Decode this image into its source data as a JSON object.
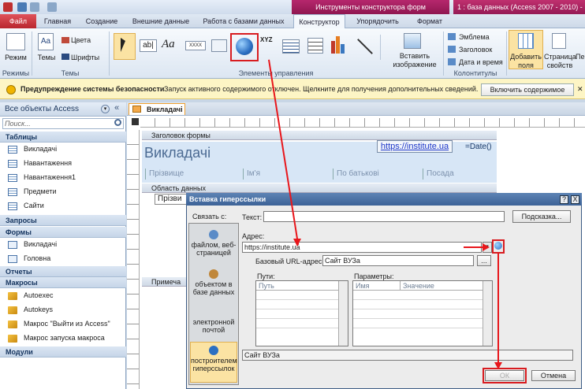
{
  "window": {
    "context_title": "Инструменты конструктора форм",
    "title": "1 : база данных (Access 2007 - 2010) - Micr"
  },
  "tabs": [
    "Файл",
    "Главная",
    "Создание",
    "Внешние данные",
    "Работа с базами данных",
    "Конструктор",
    "Упорядочить",
    "Формат"
  ],
  "ribbon": {
    "mode_label": "Режим",
    "themes_label": "Темы",
    "colors_label": "Цвета",
    "fonts_label": "Шрифты",
    "group_modes": "Режимы",
    "group_themes": "Темы",
    "group_controls": "Элементы управления",
    "group_headers": "Колонтитулы",
    "insert_image": "Вставить изображение",
    "emblem": "Эмблема",
    "heading": "Заголовок",
    "date_time": "Дата и время",
    "add_fields": "Добавить поля",
    "property_sheet": "Страница свойств",
    "controls_text": [
      "ab|",
      "Aa",
      "XXXX",
      "XYZ"
    ],
    "more": "Пе"
  },
  "security": {
    "title": "Предупреждение системы безопасности",
    "message": "Запуск активного содержимого отключен. Щелкните для получения дополнительных сведений.",
    "button": "Включить содержимое"
  },
  "nav": {
    "header": "Все объекты Access",
    "search_placeholder": "Поиск...",
    "categories": [
      {
        "name": "Таблицы",
        "items": [
          "Викладачі",
          "Навантаження",
          "Навантаження1",
          "Предмети",
          "Сайти"
        ]
      },
      {
        "name": "Запросы",
        "items": []
      },
      {
        "name": "Формы",
        "items": [
          "Викладачі",
          "Головна"
        ]
      },
      {
        "name": "Отчеты",
        "items": []
      },
      {
        "name": "Макросы",
        "items": [
          "Autoexec",
          "Autokeys",
          "Макрос \"Выйти из Access\"",
          "Макрос запуска макроса"
        ]
      },
      {
        "name": "Модули",
        "items": []
      }
    ]
  },
  "document": {
    "tab_name": "Викладачі",
    "section_header": "Заголовок формы",
    "section_detail": "Область данных",
    "section_footer": "Примеча",
    "form_title": "Викладачі",
    "hyperlink": "https://institute.ua",
    "date_fn": "=Date()",
    "columns": [
      "Прізвище",
      "Ім'я",
      "По батькові",
      "Посада"
    ],
    "detail_field": "Прізви"
  },
  "dialog": {
    "title": "Вставка гиперссылки",
    "help": "?",
    "close": "X",
    "link_to": "Связать с:",
    "text_label": "Текст:",
    "text_value": "",
    "tooltip_button": "Подсказка...",
    "address_label": "Адрес:",
    "address_value": "https://institute.ua",
    "base_url_label": "Базовый URL-адрес:",
    "base_url_value": "Сайт ВУЗа",
    "browse_button": "...",
    "paths_label": "Пути:",
    "params_label": "Параметры:",
    "paths_column": "Путь",
    "params_columns": [
      "Имя",
      "Значение"
    ],
    "preview": "Сайт ВУЗа",
    "ok": "ОК",
    "cancel": "Отмена",
    "link_options": [
      "файлом, веб-страницей",
      "объектом в базе данных",
      "электронной почтой",
      "построителем гиперссылок"
    ]
  },
  "colors": {
    "accent_red": "#e8161b",
    "file_tab": "#b8262e",
    "context_tab": "#b6276d"
  }
}
